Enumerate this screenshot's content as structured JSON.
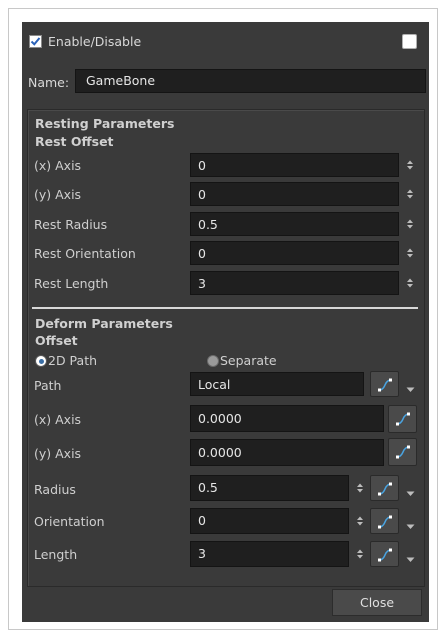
{
  "dialog": {
    "enable_label": "Enable/Disable",
    "enable_checked": true,
    "name_label": "Name:",
    "name_value": "GameBone",
    "close_label": "Close"
  },
  "resting": {
    "title": "Resting Parameters",
    "subtitle": "Rest Offset",
    "rows": [
      {
        "label": "(x) Axis",
        "value": "0"
      },
      {
        "label": "(y) Axis",
        "value": "0"
      },
      {
        "label": "Rest Radius",
        "value": "0.5"
      },
      {
        "label": "Rest Orientation",
        "value": "0"
      },
      {
        "label": "Rest Length",
        "value": "3"
      }
    ]
  },
  "deform": {
    "title": "Deform Parameters",
    "subtitle": "Offset",
    "radio_2d": "2D Path",
    "radio_separate": "Separate",
    "selected": "2D Path",
    "path_label": "Path",
    "path_value": "Local",
    "x_label": "(x) Axis",
    "x_value": "0.0000",
    "y_label": "(y) Axis",
    "y_value": "0.0000",
    "radius_label": "Radius",
    "radius_value": "0.5",
    "orientation_label": "Orientation",
    "orientation_value": "0",
    "length_label": "Length",
    "length_value": "3"
  },
  "colors": {
    "dialog_bg": "#3a3a3a",
    "field_bg": "#1f1f1f",
    "function_icon": "#4aa3df"
  },
  "icons": [
    "checkmark-icon",
    "spin-arrows-icon",
    "function-curve-icon",
    "dropdown-arrow-icon",
    "radio-icon"
  ]
}
